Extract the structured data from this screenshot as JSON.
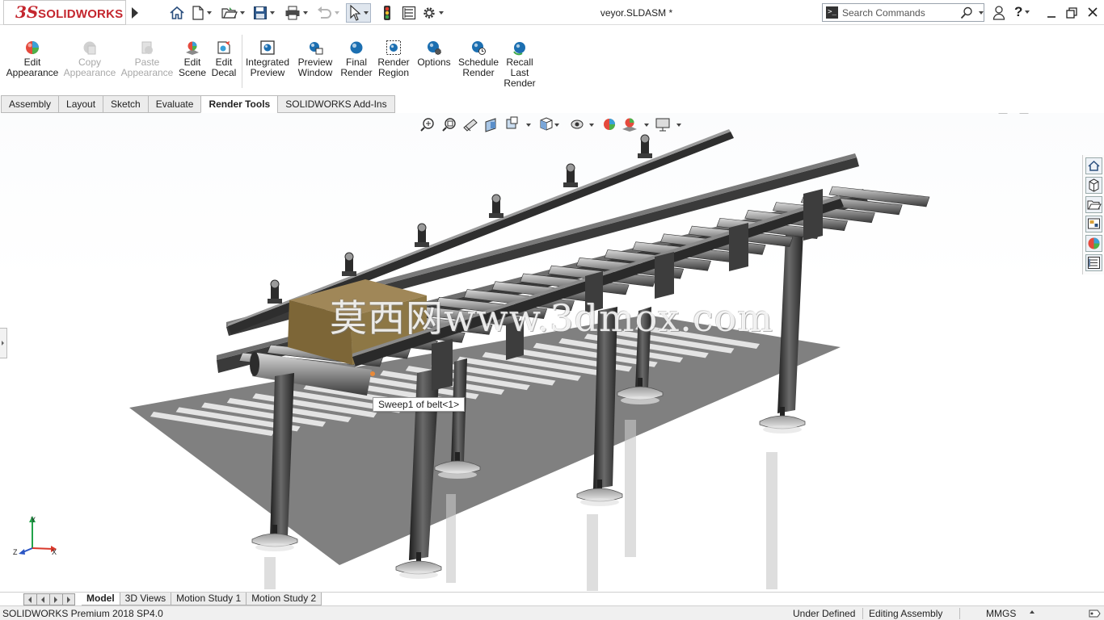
{
  "app": {
    "logo_ds": "3S",
    "logo_text": "SOLIDWORKS",
    "document_title": "veyor.SLDASM *"
  },
  "search": {
    "placeholder": "Search Commands"
  },
  "quick_access": [
    {
      "name": "home-icon"
    },
    {
      "name": "new-document-icon"
    },
    {
      "name": "open-folder-icon"
    },
    {
      "name": "save-icon"
    },
    {
      "name": "print-icon"
    },
    {
      "name": "undo-icon"
    },
    {
      "name": "select-cursor-icon"
    },
    {
      "name": "rebuild-traffic-light-icon"
    },
    {
      "name": "file-properties-icon"
    },
    {
      "name": "options-gear-icon"
    }
  ],
  "ribbon": {
    "edit_appearance": [
      "Edit",
      "Appearance"
    ],
    "copy_appearance": [
      "Copy",
      "Appearance"
    ],
    "paste_appearance": [
      "Paste",
      "Appearance"
    ],
    "edit_scene": [
      "Edit",
      "Scene"
    ],
    "edit_decal": [
      "Edit",
      "Decal"
    ],
    "integrated_preview": [
      "Integrated",
      "Preview"
    ],
    "preview_window": [
      "Preview",
      "Window"
    ],
    "final_render": [
      "Final",
      "Render"
    ],
    "render_region": [
      "Render",
      "Region"
    ],
    "options": [
      "Options"
    ],
    "schedule_render": [
      "Schedule",
      "Render"
    ],
    "recall_last_render": [
      "Recall",
      "Last",
      "Render"
    ]
  },
  "tabs": [
    {
      "label": "Assembly",
      "active": false
    },
    {
      "label": "Layout",
      "active": false
    },
    {
      "label": "Sketch",
      "active": false
    },
    {
      "label": "Evaluate",
      "active": false
    },
    {
      "label": "Render Tools",
      "active": true
    },
    {
      "label": "SOLIDWORKS Add-Ins",
      "active": false
    }
  ],
  "viewport": {
    "watermark": "莫西网www.3dmox.com",
    "tooltip": "Sweep1 of belt<1>",
    "triad_labels": {
      "y": "Y",
      "z": "Z",
      "x": "X"
    }
  },
  "bottom_tabs": [
    {
      "label": "Model",
      "active": true
    },
    {
      "label": "3D Views",
      "active": false
    },
    {
      "label": "Motion Study 1",
      "active": false
    },
    {
      "label": "Motion Study 2",
      "active": false
    }
  ],
  "status": {
    "product": "SOLIDWORKS Premium 2018 SP4.0",
    "definition": "Under Defined",
    "mode": "Editing Assembly",
    "units": "MMGS"
  },
  "colors": {
    "brand": "#c4262e",
    "frame": "#2e2e2e",
    "box": "#8a7140",
    "shadow": "#6b6b6b"
  }
}
